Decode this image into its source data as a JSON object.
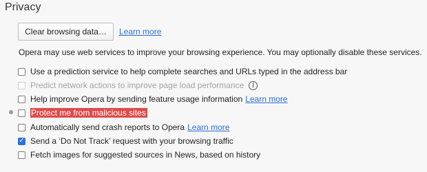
{
  "section": {
    "title": "Privacy"
  },
  "clear_browsing": {
    "button_label": "Clear browsing data…",
    "learn_more": "Learn more"
  },
  "description": "Opera may use web services to improve your browsing experience. You may optionally disable these services.",
  "options": [
    {
      "label": "Use a prediction service to help complete searches and URLs typed in the address bar",
      "checked": false,
      "disabled": false
    },
    {
      "label": "Predict network actions to improve page load performance",
      "checked": false,
      "disabled": true,
      "icon": "info-icon",
      "icon_glyph": "i"
    },
    {
      "label": "Help improve Opera by sending feature usage information",
      "link": "Learn more",
      "checked": false,
      "disabled": false
    },
    {
      "label": "Protect me from malicious sites",
      "checked": false,
      "disabled": false,
      "highlighted": true
    },
    {
      "label": "Automatically send crash reports to Opera",
      "link": "Learn more",
      "checked": false,
      "disabled": false
    },
    {
      "label": "Send a ‘Do Not Track’ request with your browsing traffic",
      "checked": true,
      "disabled": false
    },
    {
      "label": "Fetch images for suggested sources in News, based on history",
      "checked": false,
      "disabled": false
    }
  ],
  "colors": {
    "accent": "#2e72d9",
    "link": "#2b6fd6",
    "highlight": "#e14a4a",
    "background": "#f7f7f7"
  },
  "checkmark_glyph": "✓"
}
